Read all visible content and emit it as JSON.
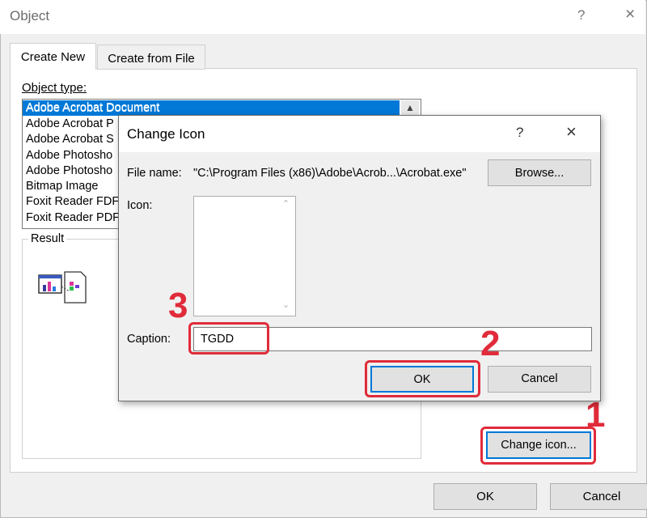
{
  "outer_dialog": {
    "title": "Object",
    "help": "?",
    "close": "×",
    "tabs": [
      {
        "label": "Create New",
        "active": true
      },
      {
        "label": "Create from File",
        "active": false
      }
    ],
    "object_type_label": "Object type:",
    "object_types": [
      {
        "label": "Adobe Acrobat Document",
        "selected": true
      },
      {
        "label": "Adobe Acrobat P",
        "selected": false
      },
      {
        "label": "Adobe Acrobat S",
        "selected": false
      },
      {
        "label": "Adobe Photosho",
        "selected": false
      },
      {
        "label": "Adobe Photosho",
        "selected": false
      },
      {
        "label": "Bitmap Image",
        "selected": false
      },
      {
        "label": "Foxit Reader FDF",
        "selected": false
      },
      {
        "label": "Foxit Reader PDF",
        "selected": false
      }
    ],
    "result_label": "Result",
    "change_icon_button": "Change icon...",
    "ok_button": "OK",
    "cancel_button": "Cancel"
  },
  "change_icon_dialog": {
    "title": "Change Icon",
    "help": "?",
    "close": "×",
    "file_name_label": "File name:",
    "file_name_value": "\"C:\\Program Files (x86)\\Adobe\\Acrob...\\Acrobat.exe\"",
    "browse_button": "Browse...",
    "icon_label": "Icon:",
    "caption_label": "Caption:",
    "caption_value": "TGDD",
    "ok_button": "OK",
    "cancel_button": "Cancel"
  },
  "annotations": [
    {
      "number": "1",
      "target": "change-icon-button"
    },
    {
      "number": "2",
      "target": "inner-ok-button"
    },
    {
      "number": "3",
      "target": "caption-input"
    }
  ],
  "colors": {
    "highlight": "#e02b3a",
    "selection": "#0078d7",
    "dialog_bg": "#f0f0f0"
  }
}
